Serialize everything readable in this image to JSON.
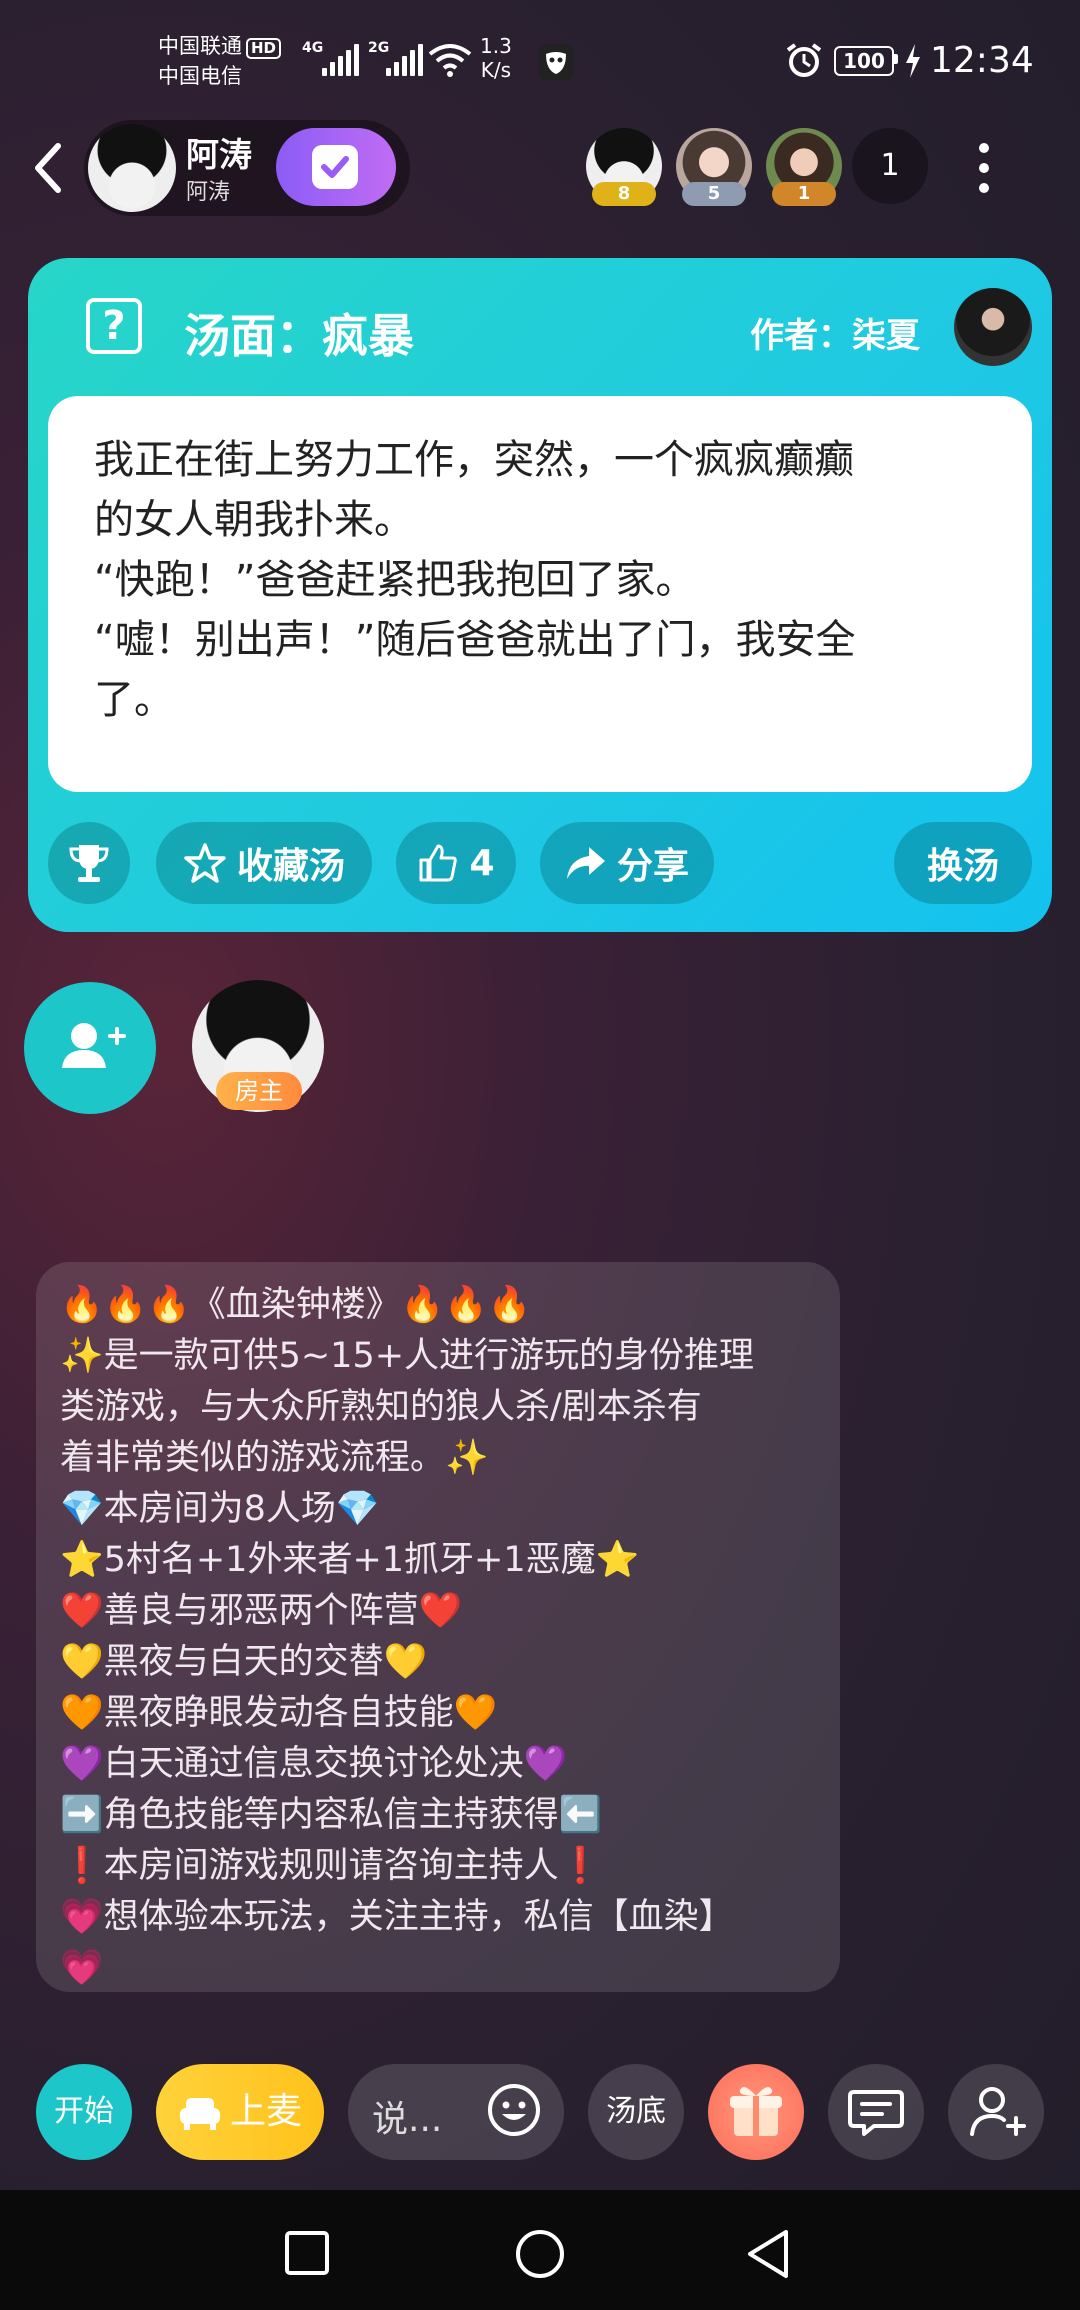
{
  "status_bar": {
    "carrier1": "中国联通",
    "hd": "HD",
    "carrier2": "中国电信",
    "net1": "4G",
    "net2": "2G",
    "speed_value": "1.3",
    "speed_unit": "K/s",
    "battery": "100",
    "time": "12:34"
  },
  "header": {
    "user_name": "阿涛",
    "user_sub": "阿涛",
    "viewers": [
      {
        "badge": "8",
        "color": "#e0b21a"
      },
      {
        "badge": "5",
        "color": "#8f9bb0"
      },
      {
        "badge": "1",
        "color": "#d2862a"
      }
    ],
    "viewer_count": "1"
  },
  "soup_card": {
    "title": "汤面：疯暴",
    "author": "作者：柒夏",
    "story": "我正在街上努力工作，突然，一个疯疯癫癫\n的女人朝我扑来。\n“快跑！”爸爸赶紧把我抱回了家。\n“嘘！别出声！”随后爸爸就出了门，我安全\n了。",
    "collect_label": "收藏汤",
    "like_count": "4",
    "share_label": "分享",
    "swap_label": "换汤"
  },
  "seats": {
    "host_badge": "房主"
  },
  "rules": {
    "text": "🔥🔥🔥《血染钟楼》🔥🔥🔥\n✨是一款可供5~15+人进行游玩的身份推理\n类游戏，与大众所熟知的狼人杀/剧本杀有\n着非常类似的游戏流程。✨\n💎本房间为8人场💎\n⭐5村名+1外来者+1抓牙+1恶魔⭐\n❤️善良与邪恶两个阵营❤️\n💛黑夜与白天的交替💛\n🧡黑夜睁眼发动各自技能🧡\n💜白天通过信息交换讨论处决💜\n➡️角色技能等内容私信主持获得⬅️\n❗本房间游戏规则请咨询主持人❗\n💗想体验本玩法，关注主持，私信【血染】\n💗"
  },
  "toolbar": {
    "start_label": "开始",
    "mic_label": "上麦",
    "say_placeholder": "说...",
    "soup_base_label": "汤底"
  },
  "colors": {
    "card_start": "#27d6c7",
    "card_end": "#13c2ef",
    "accent_teal": "#1cc6c9",
    "mic_yellow": "#ffc21c"
  }
}
